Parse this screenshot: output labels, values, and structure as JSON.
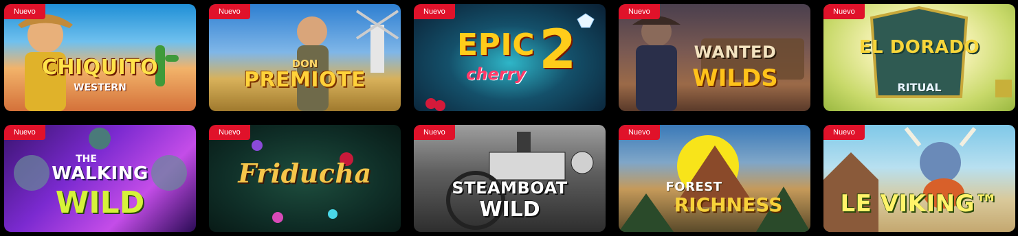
{
  "badge_label": "Nuevo",
  "games": [
    {
      "title": "CHIQUITO",
      "subtitle": "WESTERN"
    },
    {
      "title": "PREMIOTE",
      "subtitle": "DON"
    },
    {
      "title": "EPIC",
      "subtitle": "cherry",
      "number": "2"
    },
    {
      "title": "WANTED",
      "subtitle": "WILDS"
    },
    {
      "title": "EL DORADO",
      "subtitle": "RITUAL"
    },
    {
      "title": "WALKING",
      "pre": "THE",
      "subtitle": "WILD"
    },
    {
      "title": "Friducha"
    },
    {
      "title": "STEAMBOAT",
      "subtitle": "WILD"
    },
    {
      "title": "FOREST",
      "subtitle": "RICHNESS"
    },
    {
      "title": "LE VIKING™"
    }
  ],
  "colors": {
    "badge": "#e0122a",
    "page_background": "#000000"
  }
}
